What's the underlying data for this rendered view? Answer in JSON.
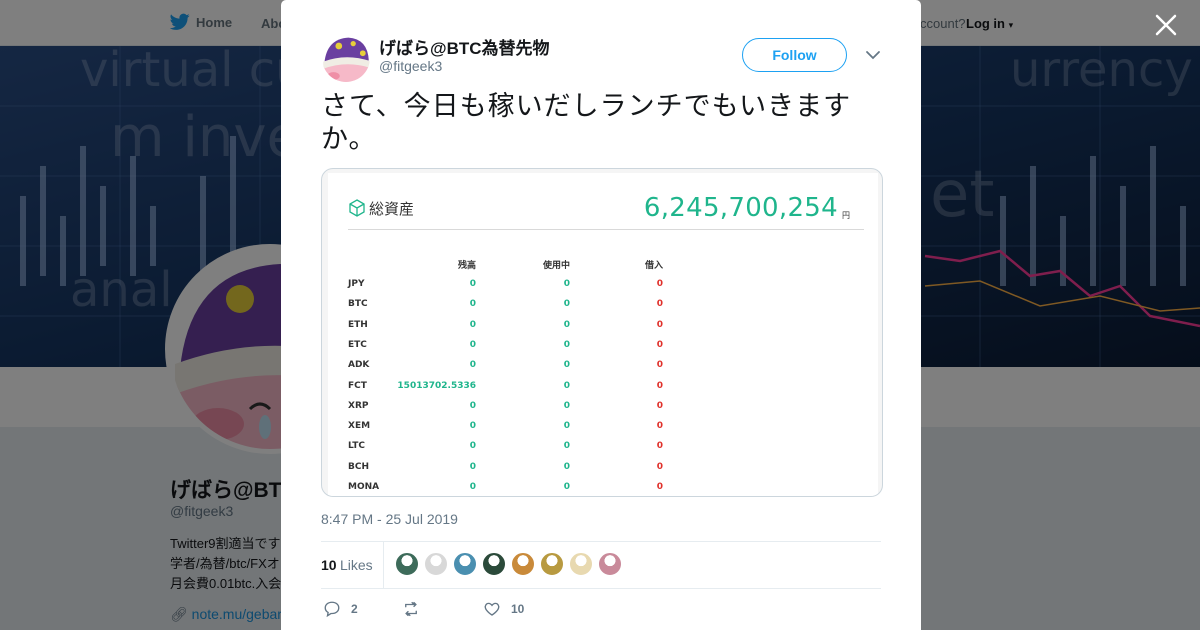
{
  "nav": {
    "home_label": "Home",
    "about_label": "Abo",
    "account_prompt": "ccount?",
    "login_label": "Log in"
  },
  "profile": {
    "name": "げばら@BT",
    "handle": "@fitgeek3",
    "bio_lines": [
      "Twitter9割適当です",
      "学者/為替/btc/FXオ",
      "月会費0.01btc.入会"
    ],
    "link": "note.mu/gebar"
  },
  "tweet": {
    "author_name": "げばら@BTC為替先物",
    "author_handle": "@fitgeek3",
    "follow_label": "Follow",
    "text": "さて、今日も稼いだしランチでもいきますか。",
    "timestamp": "8:47 PM - 25 Jul 2019",
    "likes_count": "10",
    "likes_label": "Likes",
    "reply_count": "2",
    "retweet_count": "",
    "like_count": "10"
  },
  "card": {
    "title": "総資産",
    "total_value": "6,245,700,254",
    "unit": "円",
    "headers": [
      "残高",
      "使用中",
      "借入"
    ],
    "rows": [
      {
        "name": "JPY",
        "balance": "0",
        "in_use": "0",
        "borrowed": "0"
      },
      {
        "name": "BTC",
        "balance": "0",
        "in_use": "0",
        "borrowed": "0"
      },
      {
        "name": "ETH",
        "balance": "0",
        "in_use": "0",
        "borrowed": "0"
      },
      {
        "name": "ETC",
        "balance": "0",
        "in_use": "0",
        "borrowed": "0"
      },
      {
        "name": "ADK",
        "balance": "0",
        "in_use": "0",
        "borrowed": "0"
      },
      {
        "name": "FCT",
        "balance": "15013702.5336",
        "in_use": "0",
        "borrowed": "0"
      },
      {
        "name": "XRP",
        "balance": "0",
        "in_use": "0",
        "borrowed": "0"
      },
      {
        "name": "XEM",
        "balance": "0",
        "in_use": "0",
        "borrowed": "0"
      },
      {
        "name": "LTC",
        "balance": "0",
        "in_use": "0",
        "borrowed": "0"
      },
      {
        "name": "BCH",
        "balance": "0",
        "in_use": "0",
        "borrowed": "0"
      },
      {
        "name": "MONA",
        "balance": "0",
        "in_use": "0",
        "borrowed": "0"
      }
    ]
  },
  "colors": {
    "twitter_blue": "#1da1f2",
    "value_green": "#1fb58c",
    "borrow_red": "#e0302a",
    "liker_colors": [
      "#3d6b5a",
      "#d8d8d8",
      "#4a8fb0",
      "#2b4a3a",
      "#c98a3a",
      "#b89a40",
      "#e8d9b0",
      "#c98a9a"
    ]
  }
}
